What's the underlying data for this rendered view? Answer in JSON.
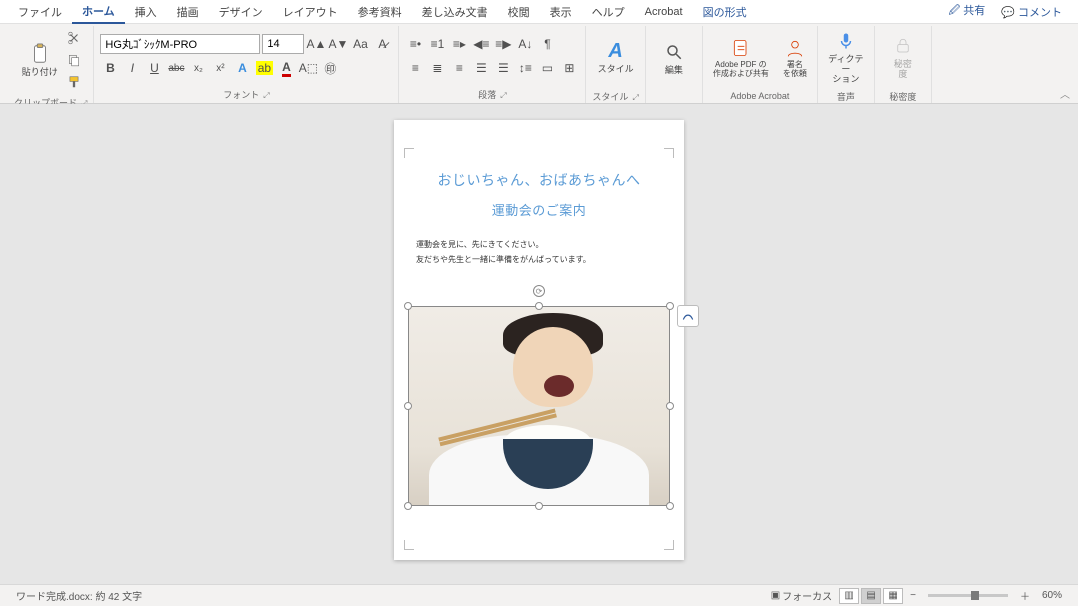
{
  "menu": {
    "items": [
      "ファイル",
      "ホーム",
      "挿入",
      "描画",
      "デザイン",
      "レイアウト",
      "参考資料",
      "差し込み文書",
      "校閲",
      "表示",
      "ヘルプ",
      "Acrobat",
      "図の形式"
    ],
    "active_index": 1,
    "share": "共有",
    "comments": "コメント"
  },
  "ribbon": {
    "clipboard": {
      "paste": "貼り付け",
      "label": "クリップボード"
    },
    "font": {
      "family": "HG丸ｺﾞｼｯｸM-PRO",
      "size": "14",
      "label": "フォント",
      "bold": "B",
      "italic": "I",
      "underline": "U",
      "strike": "abc",
      "sub": "x₂",
      "sup": "x²",
      "case": "Aa"
    },
    "paragraph": {
      "label": "段落"
    },
    "styles": {
      "btn": "スタイル",
      "label": "スタイル"
    },
    "editing": {
      "btn": "編集"
    },
    "acrobat": {
      "pdf": "Adobe PDF の\n作成および共有",
      "sign": "署名\nを依頼",
      "label": "Adobe Acrobat"
    },
    "voice": {
      "dictate": "ディクテー\nション",
      "label": "音声"
    },
    "secrecy": {
      "btn": "秘密\n度",
      "label": "秘密度"
    }
  },
  "document": {
    "title1": "おじいちゃん、おばあちゃんへ",
    "title2": "運動会のご案内",
    "line1": "運動会を見に、先にきてください。",
    "line2": "友だちや先生と一緒に準備をがんばっています。"
  },
  "status": {
    "file_info": "ワード完成.docx: 約 42 文字",
    "focus": "フォーカス",
    "zoom": "60%"
  }
}
